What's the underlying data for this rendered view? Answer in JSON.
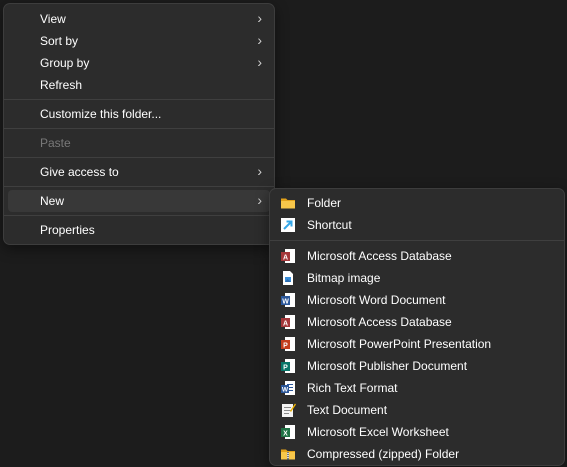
{
  "context_menu": {
    "items": [
      {
        "label": "View",
        "has_submenu": true
      },
      {
        "label": "Sort by",
        "has_submenu": true
      },
      {
        "label": "Group by",
        "has_submenu": true
      },
      {
        "label": "Refresh"
      },
      {
        "label": "Customize this folder..."
      },
      {
        "label": "Paste",
        "disabled": true
      },
      {
        "label": "Give access to",
        "has_submenu": true
      },
      {
        "label": "New",
        "has_submenu": true,
        "selected": true
      },
      {
        "label": "Properties"
      }
    ],
    "chevron": "›"
  },
  "new_submenu": {
    "items": [
      {
        "label": "Folder",
        "icon": "folder-icon"
      },
      {
        "label": "Shortcut",
        "icon": "shortcut-icon"
      },
      {
        "label": "Microsoft Access Database",
        "icon": "access-icon"
      },
      {
        "label": "Bitmap image",
        "icon": "bitmap-icon"
      },
      {
        "label": "Microsoft Word Document",
        "icon": "word-icon"
      },
      {
        "label": "Microsoft Access Database",
        "icon": "access-icon"
      },
      {
        "label": "Microsoft PowerPoint Presentation",
        "icon": "powerpoint-icon"
      },
      {
        "label": "Microsoft Publisher Document",
        "icon": "publisher-icon"
      },
      {
        "label": "Rich Text Format",
        "icon": "rtf-icon"
      },
      {
        "label": "Text Document",
        "icon": "text-document-icon"
      },
      {
        "label": "Microsoft Excel Worksheet",
        "icon": "excel-icon"
      },
      {
        "label": "Compressed (zipped) Folder",
        "icon": "zip-folder-icon"
      }
    ]
  },
  "colors": {
    "menu_bg": "#2c2c2c",
    "selected_bg": "#383838",
    "disabled_text": "#787878",
    "word": "#2b579a",
    "access": "#a4373a",
    "powerpoint": "#c43e1c",
    "publisher": "#077568",
    "excel": "#217346",
    "folder": "#f8c74a",
    "shortcut": "#35a7e8"
  }
}
